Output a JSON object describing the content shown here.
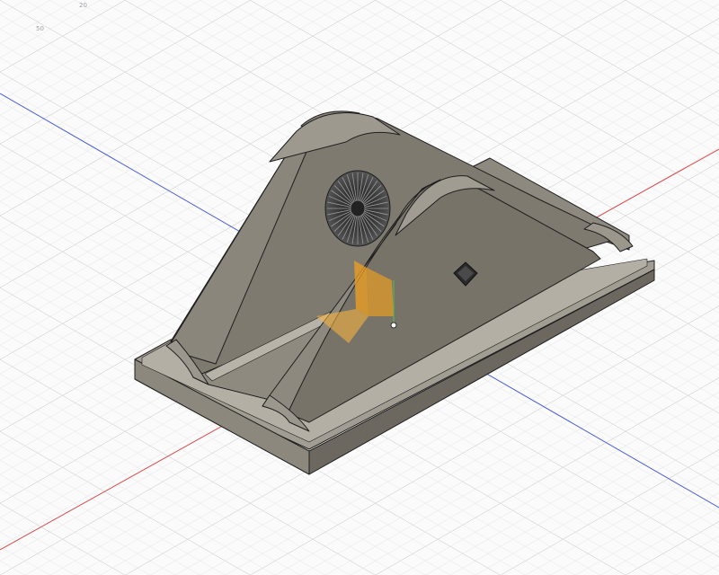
{
  "viewport": {
    "view_type": "isometric 3D model viewport",
    "grid": true,
    "origin_axis_colors": {
      "x_axis": "#d94a4a",
      "y_axis": "#4a5fd9",
      "z_axis": "#4ac04a"
    }
  },
  "ruler_labels": [
    "20",
    "50"
  ],
  "model": {
    "body_color": "#8a857a",
    "face_dark": "#6e6a60",
    "face_mid": "#7f7a70",
    "face_light": "#9b968b",
    "edge_color": "#1e1e1e",
    "features": [
      "base-plate",
      "left-arm",
      "right-arm",
      "radial-fan-grille",
      "square-hole",
      "center-rod"
    ]
  },
  "manipulator": {
    "color": "#f0a020",
    "pivot_color": "#2b2b2b"
  }
}
